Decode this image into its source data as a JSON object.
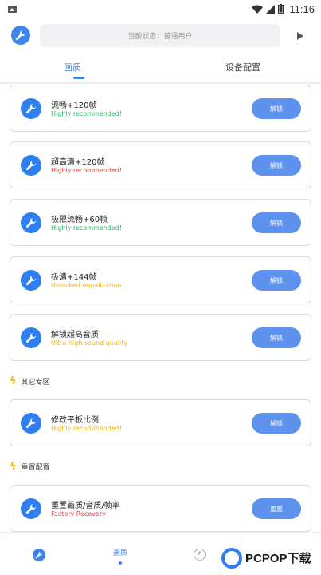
{
  "statusbar": {
    "time": "11:16",
    "icons": [
      "image-icon",
      "wifi-icon",
      "signal-icon",
      "battery-icon"
    ]
  },
  "topbar": {
    "status_text": "当前状态：普通用户",
    "app_icon": "wrench-icon",
    "play_icon": "play-icon"
  },
  "tabs": [
    {
      "label": "画质"
    },
    {
      "label": "设备配置"
    }
  ],
  "cards": [
    {
      "title": "流畅+120帧",
      "subtitle": "Highly recommended!",
      "subtitle_color": "#28b463",
      "button": "解锁"
    },
    {
      "title": "超高清+120帧",
      "subtitle": "Highly recommended!",
      "subtitle_color": "#e53935",
      "button": "解锁"
    },
    {
      "title": "极限流畅+60帧",
      "subtitle": "Highly recommended!",
      "subtitle_color": "#28b463",
      "button": "解锁"
    },
    {
      "title": "极清+144帧",
      "subtitle": "Unlocked equalization",
      "subtitle_color": "#f0b400",
      "button": "解锁"
    },
    {
      "title": "解锁超高音质",
      "subtitle": "Ultra high sound quality",
      "subtitle_color": "#f0b400",
      "button": "解锁"
    },
    {
      "title": "修改平板比例",
      "subtitle": "Highly recommended!",
      "subtitle_color": "#f0b400",
      "button": "解锁"
    },
    {
      "title": "重置画质/音质/帧率",
      "subtitle": "Factory Recovery",
      "subtitle_color": "#e53935",
      "button": "重置"
    }
  ],
  "sections": [
    {
      "label": "其它专区"
    },
    {
      "label": "重置配置"
    }
  ],
  "bottomnav": {
    "items": [
      {
        "icon": "wrench-icon"
      },
      {
        "label": "画质"
      },
      {
        "icon": "clock-icon"
      }
    ]
  },
  "watermark": {
    "text": "PCPOP下载"
  },
  "colors": {
    "accent": "#3d86f0",
    "button": "#5d93ee"
  }
}
